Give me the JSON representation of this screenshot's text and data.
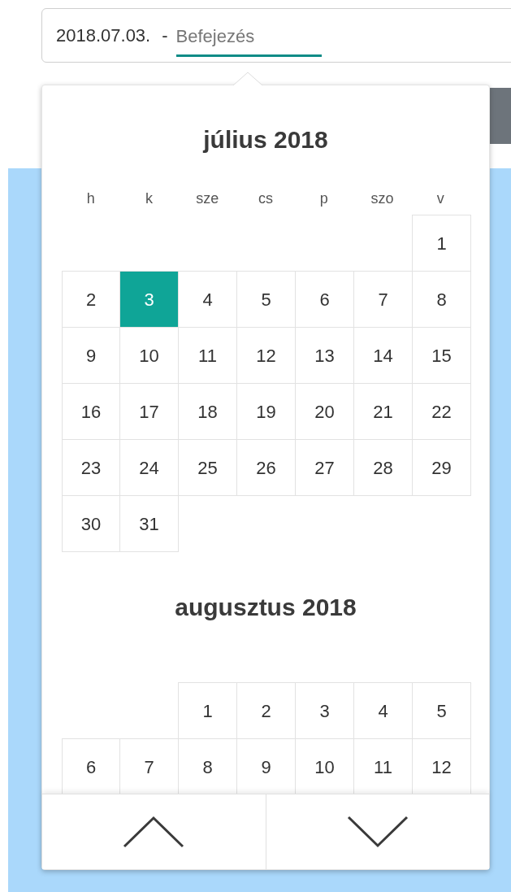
{
  "range_field": {
    "start_value": "2018.07.03.",
    "separator": "-",
    "end_placeholder": "Befejezés",
    "end_focused": true
  },
  "calendar": {
    "months": [
      {
        "title": "július 2018",
        "weekdays": [
          "h",
          "k",
          "sze",
          "cs",
          "p",
          "szo",
          "v"
        ],
        "weeks": [
          [
            {
              "kind": "blank"
            },
            {
              "kind": "blank"
            },
            {
              "kind": "blank"
            },
            {
              "kind": "blank"
            },
            {
              "kind": "blank"
            },
            {
              "kind": "blank"
            },
            {
              "kind": "day",
              "day": "1",
              "selected": false
            }
          ],
          [
            {
              "kind": "day",
              "day": "2",
              "selected": false
            },
            {
              "kind": "day",
              "day": "3",
              "selected": true
            },
            {
              "kind": "day",
              "day": "4",
              "selected": false
            },
            {
              "kind": "day",
              "day": "5",
              "selected": false
            },
            {
              "kind": "day",
              "day": "6",
              "selected": false
            },
            {
              "kind": "day",
              "day": "7",
              "selected": false
            },
            {
              "kind": "day",
              "day": "8",
              "selected": false
            }
          ],
          [
            {
              "kind": "day",
              "day": "9",
              "selected": false
            },
            {
              "kind": "day",
              "day": "10",
              "selected": false
            },
            {
              "kind": "day",
              "day": "11",
              "selected": false
            },
            {
              "kind": "day",
              "day": "12",
              "selected": false
            },
            {
              "kind": "day",
              "day": "13",
              "selected": false
            },
            {
              "kind": "day",
              "day": "14",
              "selected": false
            },
            {
              "kind": "day",
              "day": "15",
              "selected": false
            }
          ],
          [
            {
              "kind": "day",
              "day": "16",
              "selected": false
            },
            {
              "kind": "day",
              "day": "17",
              "selected": false
            },
            {
              "kind": "day",
              "day": "18",
              "selected": false
            },
            {
              "kind": "day",
              "day": "19",
              "selected": false
            },
            {
              "kind": "day",
              "day": "20",
              "selected": false
            },
            {
              "kind": "day",
              "day": "21",
              "selected": false
            },
            {
              "kind": "day",
              "day": "22",
              "selected": false
            }
          ],
          [
            {
              "kind": "day",
              "day": "23",
              "selected": false
            },
            {
              "kind": "day",
              "day": "24",
              "selected": false
            },
            {
              "kind": "day",
              "day": "25",
              "selected": false
            },
            {
              "kind": "day",
              "day": "26",
              "selected": false
            },
            {
              "kind": "day",
              "day": "27",
              "selected": false
            },
            {
              "kind": "day",
              "day": "28",
              "selected": false
            },
            {
              "kind": "day",
              "day": "29",
              "selected": false
            }
          ],
          [
            {
              "kind": "day",
              "day": "30",
              "selected": false
            },
            {
              "kind": "day",
              "day": "31",
              "selected": false
            },
            {
              "kind": "blank"
            },
            {
              "kind": "blank"
            },
            {
              "kind": "blank"
            },
            {
              "kind": "blank"
            },
            {
              "kind": "blank"
            }
          ]
        ]
      },
      {
        "title": "augusztus 2018",
        "weeks": [
          [
            {
              "kind": "blank"
            },
            {
              "kind": "blank"
            },
            {
              "kind": "day",
              "day": "1",
              "selected": false
            },
            {
              "kind": "day",
              "day": "2",
              "selected": false
            },
            {
              "kind": "day",
              "day": "3",
              "selected": false
            },
            {
              "kind": "day",
              "day": "4",
              "selected": false
            },
            {
              "kind": "day",
              "day": "5",
              "selected": false
            }
          ],
          [
            {
              "kind": "day",
              "day": "6",
              "selected": false
            },
            {
              "kind": "day",
              "day": "7",
              "selected": false
            },
            {
              "kind": "day",
              "day": "8",
              "selected": false
            },
            {
              "kind": "day",
              "day": "9",
              "selected": false
            },
            {
              "kind": "day",
              "day": "10",
              "selected": false
            },
            {
              "kind": "day",
              "day": "11",
              "selected": false
            },
            {
              "kind": "day",
              "day": "12",
              "selected": false
            }
          ]
        ]
      }
    ]
  }
}
